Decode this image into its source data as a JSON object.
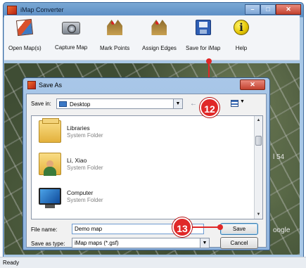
{
  "window": {
    "title": "iMap Converter",
    "controls": {
      "minimize": "–",
      "maximize": "□",
      "close": "✕"
    }
  },
  "toolbar": {
    "items": [
      {
        "label": "Open Map(s)",
        "icon": "open-maps-icon"
      },
      {
        "label": "Capture Map",
        "icon": "camera-icon"
      },
      {
        "label": "Mark Points",
        "icon": "mark-points-icon"
      },
      {
        "label": "Assign Edges",
        "icon": "assign-edges-icon"
      },
      {
        "label": "Save for iMap",
        "icon": "save-icon"
      },
      {
        "label": "Help",
        "icon": "help-icon",
        "glyph": "i"
      }
    ]
  },
  "map": {
    "labels": [
      "l 54",
      "oogle"
    ]
  },
  "dialog": {
    "title": "Save As",
    "close": "✕",
    "save_in_label": "Save in:",
    "save_in_value": "Desktop",
    "back_arrow": "←",
    "items": [
      {
        "name": "Libraries",
        "type": "System Folder",
        "icon": "libraries-folder-icon"
      },
      {
        "name": "Li, Xiao",
        "type": "System Folder",
        "icon": "user-folder-icon"
      },
      {
        "name": "Computer",
        "type": "System Folder",
        "icon": "computer-icon"
      }
    ],
    "file_name_label": "File name:",
    "file_name_value": "Demo map",
    "save_type_label": "Save as type:",
    "save_type_value": "iMap maps (*.gsf)",
    "save_button": "Save",
    "cancel_button": "Cancel"
  },
  "callouts": {
    "step_12": "12",
    "step_13": "13",
    "color": "#e02828"
  },
  "status": {
    "text": "Ready"
  }
}
